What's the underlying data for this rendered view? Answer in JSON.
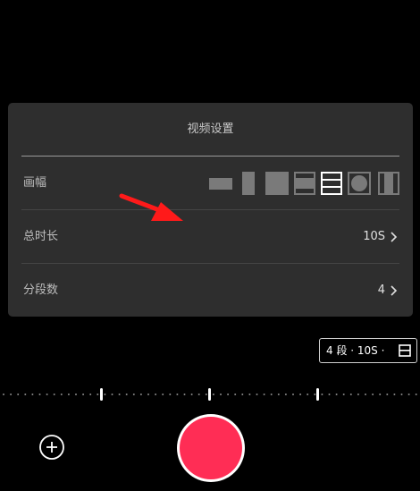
{
  "settings_panel": {
    "title": "视频设置",
    "aspect_row": {
      "label": "画幅",
      "options": [
        {
          "icon": "landscape-ratio-icon",
          "selected": false
        },
        {
          "icon": "portrait-ratio-icon",
          "selected": false
        },
        {
          "icon": "square-ratio-icon",
          "selected": false
        },
        {
          "icon": "letterbox-ratio-icon",
          "selected": false
        },
        {
          "icon": "widescreen-ratio-icon",
          "selected": true
        },
        {
          "icon": "circle-ratio-icon",
          "selected": false
        },
        {
          "icon": "pillarbox-ratio-icon",
          "selected": false
        }
      ]
    },
    "duration_row": {
      "label": "总时长",
      "value": "10S"
    },
    "segments_row": {
      "label": "分段数",
      "value": "4"
    }
  },
  "summary_badge": {
    "text": "4 段 · 10S ·"
  },
  "colors": {
    "panel_bg": "#2e2e2e",
    "record": "#ff2d55",
    "arrow": "#ff1a1a",
    "selected_icon": "#ffffff",
    "unselected_icon": "#7a7a7a"
  }
}
